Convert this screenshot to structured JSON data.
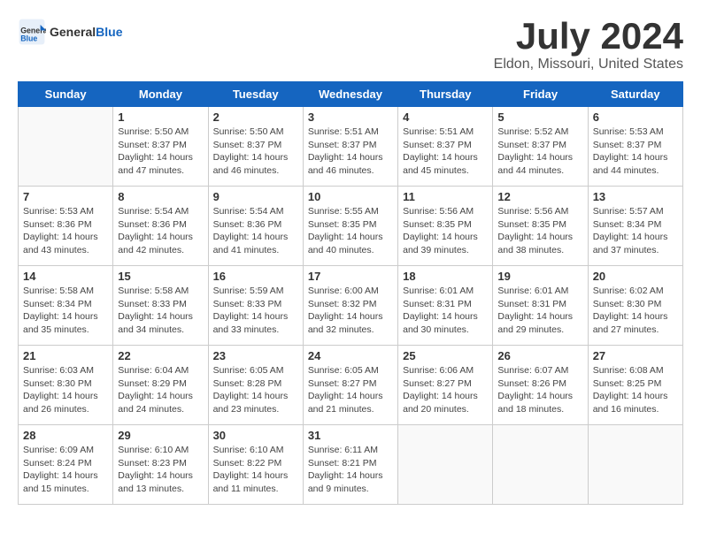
{
  "header": {
    "logo_general": "General",
    "logo_blue": "Blue",
    "month_title": "July 2024",
    "location": "Eldon, Missouri, United States"
  },
  "weekdays": [
    "Sunday",
    "Monday",
    "Tuesday",
    "Wednesday",
    "Thursday",
    "Friday",
    "Saturday"
  ],
  "weeks": [
    [
      {
        "day": "",
        "info": ""
      },
      {
        "day": "1",
        "info": "Sunrise: 5:50 AM\nSunset: 8:37 PM\nDaylight: 14 hours\nand 47 minutes."
      },
      {
        "day": "2",
        "info": "Sunrise: 5:50 AM\nSunset: 8:37 PM\nDaylight: 14 hours\nand 46 minutes."
      },
      {
        "day": "3",
        "info": "Sunrise: 5:51 AM\nSunset: 8:37 PM\nDaylight: 14 hours\nand 46 minutes."
      },
      {
        "day": "4",
        "info": "Sunrise: 5:51 AM\nSunset: 8:37 PM\nDaylight: 14 hours\nand 45 minutes."
      },
      {
        "day": "5",
        "info": "Sunrise: 5:52 AM\nSunset: 8:37 PM\nDaylight: 14 hours\nand 44 minutes."
      },
      {
        "day": "6",
        "info": "Sunrise: 5:53 AM\nSunset: 8:37 PM\nDaylight: 14 hours\nand 44 minutes."
      }
    ],
    [
      {
        "day": "7",
        "info": "Sunrise: 5:53 AM\nSunset: 8:36 PM\nDaylight: 14 hours\nand 43 minutes."
      },
      {
        "day": "8",
        "info": "Sunrise: 5:54 AM\nSunset: 8:36 PM\nDaylight: 14 hours\nand 42 minutes."
      },
      {
        "day": "9",
        "info": "Sunrise: 5:54 AM\nSunset: 8:36 PM\nDaylight: 14 hours\nand 41 minutes."
      },
      {
        "day": "10",
        "info": "Sunrise: 5:55 AM\nSunset: 8:35 PM\nDaylight: 14 hours\nand 40 minutes."
      },
      {
        "day": "11",
        "info": "Sunrise: 5:56 AM\nSunset: 8:35 PM\nDaylight: 14 hours\nand 39 minutes."
      },
      {
        "day": "12",
        "info": "Sunrise: 5:56 AM\nSunset: 8:35 PM\nDaylight: 14 hours\nand 38 minutes."
      },
      {
        "day": "13",
        "info": "Sunrise: 5:57 AM\nSunset: 8:34 PM\nDaylight: 14 hours\nand 37 minutes."
      }
    ],
    [
      {
        "day": "14",
        "info": "Sunrise: 5:58 AM\nSunset: 8:34 PM\nDaylight: 14 hours\nand 35 minutes."
      },
      {
        "day": "15",
        "info": "Sunrise: 5:58 AM\nSunset: 8:33 PM\nDaylight: 14 hours\nand 34 minutes."
      },
      {
        "day": "16",
        "info": "Sunrise: 5:59 AM\nSunset: 8:33 PM\nDaylight: 14 hours\nand 33 minutes."
      },
      {
        "day": "17",
        "info": "Sunrise: 6:00 AM\nSunset: 8:32 PM\nDaylight: 14 hours\nand 32 minutes."
      },
      {
        "day": "18",
        "info": "Sunrise: 6:01 AM\nSunset: 8:31 PM\nDaylight: 14 hours\nand 30 minutes."
      },
      {
        "day": "19",
        "info": "Sunrise: 6:01 AM\nSunset: 8:31 PM\nDaylight: 14 hours\nand 29 minutes."
      },
      {
        "day": "20",
        "info": "Sunrise: 6:02 AM\nSunset: 8:30 PM\nDaylight: 14 hours\nand 27 minutes."
      }
    ],
    [
      {
        "day": "21",
        "info": "Sunrise: 6:03 AM\nSunset: 8:30 PM\nDaylight: 14 hours\nand 26 minutes."
      },
      {
        "day": "22",
        "info": "Sunrise: 6:04 AM\nSunset: 8:29 PM\nDaylight: 14 hours\nand 24 minutes."
      },
      {
        "day": "23",
        "info": "Sunrise: 6:05 AM\nSunset: 8:28 PM\nDaylight: 14 hours\nand 23 minutes."
      },
      {
        "day": "24",
        "info": "Sunrise: 6:05 AM\nSunset: 8:27 PM\nDaylight: 14 hours\nand 21 minutes."
      },
      {
        "day": "25",
        "info": "Sunrise: 6:06 AM\nSunset: 8:27 PM\nDaylight: 14 hours\nand 20 minutes."
      },
      {
        "day": "26",
        "info": "Sunrise: 6:07 AM\nSunset: 8:26 PM\nDaylight: 14 hours\nand 18 minutes."
      },
      {
        "day": "27",
        "info": "Sunrise: 6:08 AM\nSunset: 8:25 PM\nDaylight: 14 hours\nand 16 minutes."
      }
    ],
    [
      {
        "day": "28",
        "info": "Sunrise: 6:09 AM\nSunset: 8:24 PM\nDaylight: 14 hours\nand 15 minutes."
      },
      {
        "day": "29",
        "info": "Sunrise: 6:10 AM\nSunset: 8:23 PM\nDaylight: 14 hours\nand 13 minutes."
      },
      {
        "day": "30",
        "info": "Sunrise: 6:10 AM\nSunset: 8:22 PM\nDaylight: 14 hours\nand 11 minutes."
      },
      {
        "day": "31",
        "info": "Sunrise: 6:11 AM\nSunset: 8:21 PM\nDaylight: 14 hours\nand 9 minutes."
      },
      {
        "day": "",
        "info": ""
      },
      {
        "day": "",
        "info": ""
      },
      {
        "day": "",
        "info": ""
      }
    ]
  ]
}
